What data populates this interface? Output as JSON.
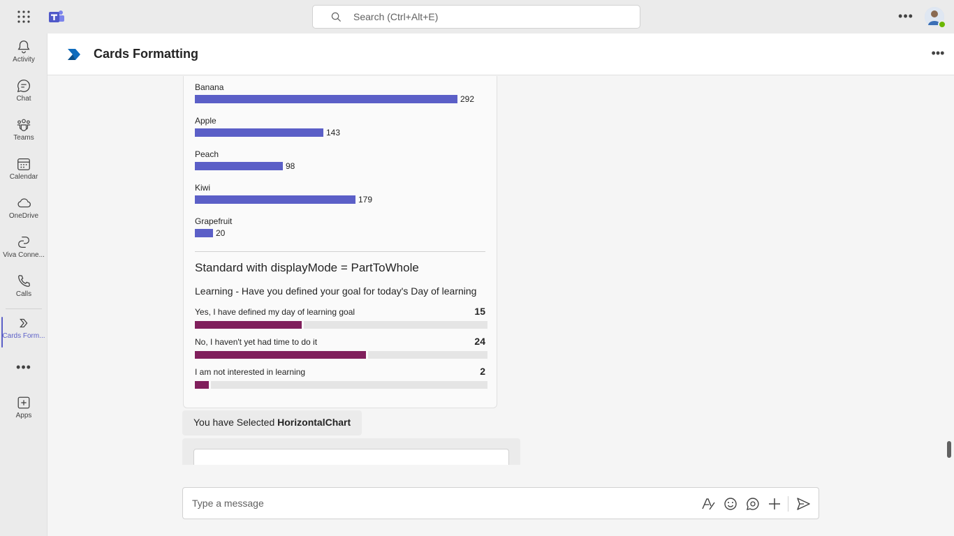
{
  "search": {
    "placeholder": "Search (Ctrl+Alt+E)"
  },
  "rail": {
    "items": [
      {
        "label": "Activity",
        "icon": "bell-icon"
      },
      {
        "label": "Chat",
        "icon": "chat-icon"
      },
      {
        "label": "Teams",
        "icon": "teams-icon"
      },
      {
        "label": "Calendar",
        "icon": "calendar-icon"
      },
      {
        "label": "OneDrive",
        "icon": "cloud-icon"
      },
      {
        "label": "Viva Conne...",
        "icon": "viva-connections-icon"
      },
      {
        "label": "Calls",
        "icon": "phone-icon"
      },
      {
        "label": "Cards Form...",
        "icon": "app-icon"
      },
      {
        "label": "Apps",
        "icon": "add-app-icon"
      }
    ]
  },
  "header": {
    "title": "Cards Formatting"
  },
  "chart_data": [
    {
      "type": "bar",
      "orientation": "horizontal",
      "categories": [
        "Banana",
        "Apple",
        "Peach",
        "Kiwi",
        "Grapefruit"
      ],
      "values": [
        292,
        143,
        98,
        179,
        20
      ],
      "color": "#5b5fc7"
    },
    {
      "type": "bar",
      "orientation": "horizontal",
      "title": "Standard with displayMode = PartToWhole",
      "subtitle": "Learning - Have you defined your goal for today's Day of learning",
      "categories": [
        "Yes, I have defined my day of learning goal",
        "No, I haven't yet had time to do it",
        "I am not interested in learning"
      ],
      "values": [
        15,
        24,
        2
      ],
      "color": "#801f5c",
      "track_color": "#e5e5e5"
    }
  ],
  "messages": {
    "selected_prefix": "You have Selected ",
    "selected_value": "HorizontalChart"
  },
  "compose": {
    "placeholder": "Type a message"
  },
  "colors": {
    "accent": "#5b5fc7",
    "part_to_whole": "#801f5c"
  }
}
